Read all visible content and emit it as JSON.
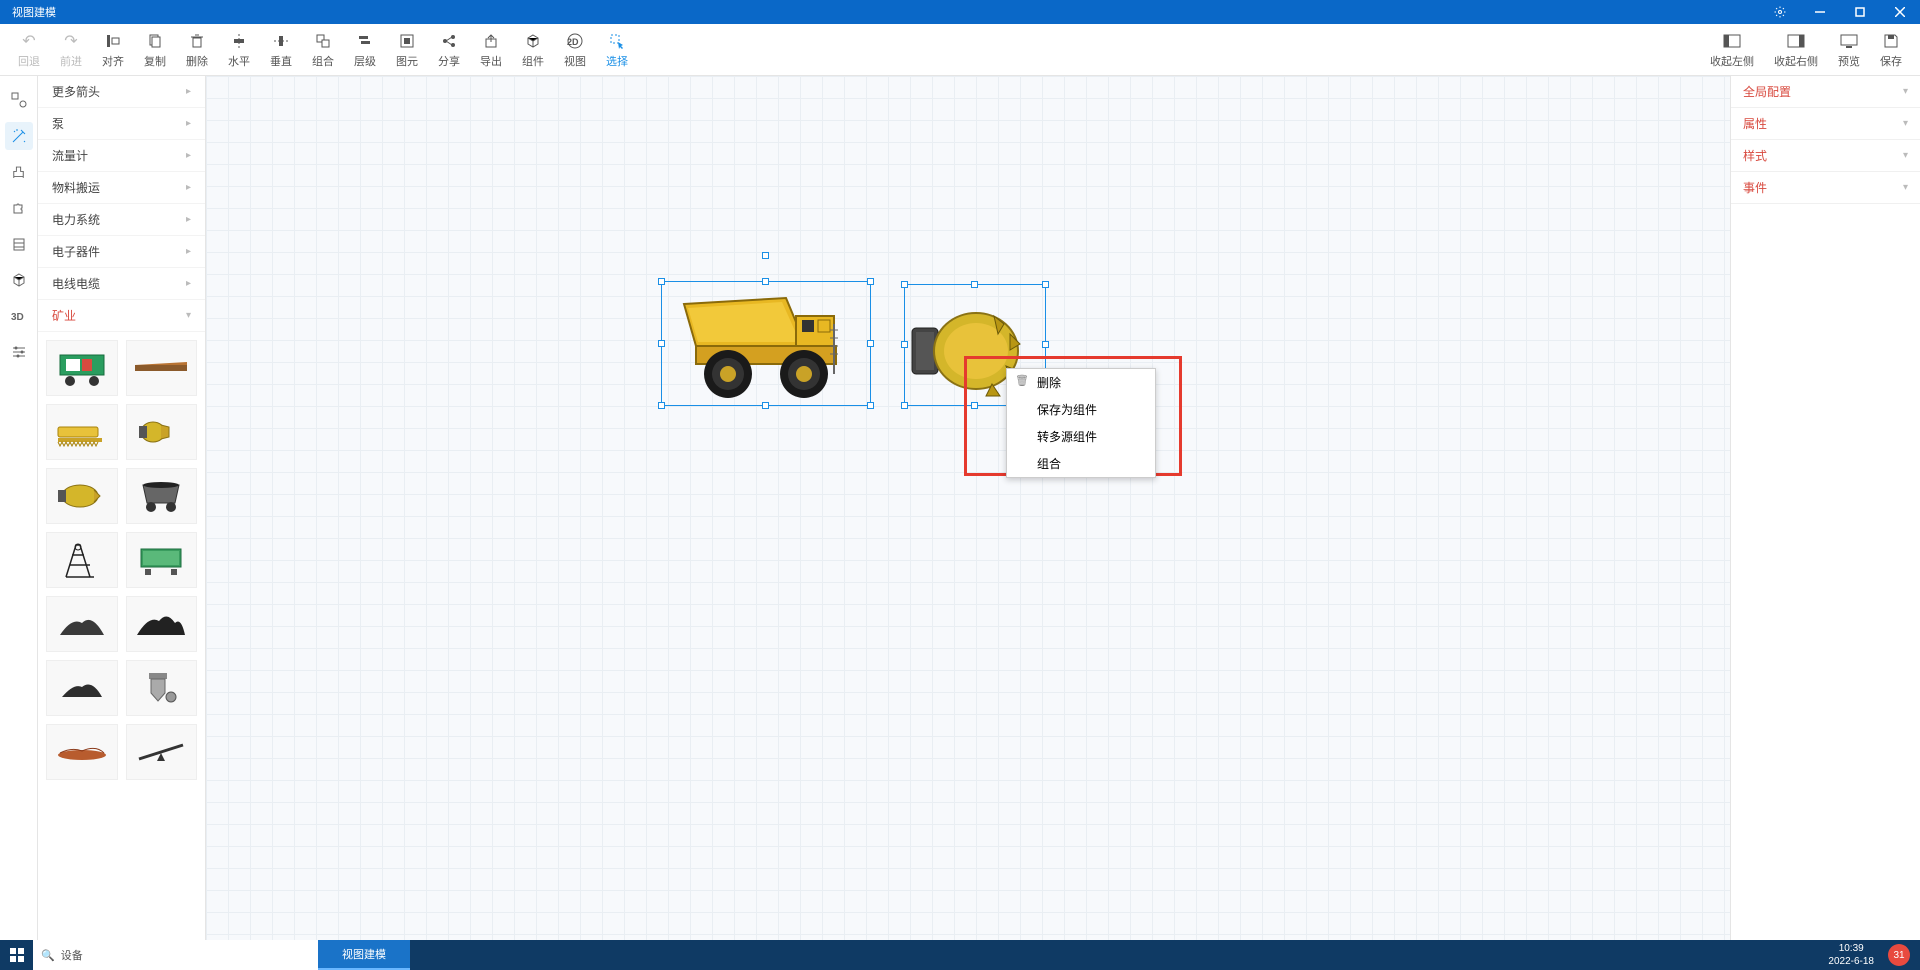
{
  "titlebar": {
    "title": "视图建模"
  },
  "toolbar": {
    "undo": "回退",
    "redo": "前进",
    "align": "对齐",
    "copy": "复制",
    "delete": "删除",
    "horiz": "水平",
    "vert": "垂直",
    "group": "组合",
    "layer": "层级",
    "element": "图元",
    "share": "分享",
    "export": "导出",
    "component": "组件",
    "view": "视图",
    "select": "选择",
    "collapse_left": "收起左侧",
    "collapse_right": "收起右侧",
    "preview": "预览",
    "save": "保存"
  },
  "sidebar_categories": [
    "更多箭头",
    "泵",
    "流量计",
    "物料搬运",
    "电力系统",
    "电子器件",
    "电线电缆",
    "矿业"
  ],
  "context_menu": {
    "delete": "删除",
    "save_as_component": "保存为组件",
    "convert_multisource": "转多源组件",
    "combine": "组合"
  },
  "right_panel": {
    "global": "全局配置",
    "properties": "属性",
    "style": "样式",
    "events": "事件"
  },
  "taskbar": {
    "search_placeholder": "设备",
    "app": "视图建模",
    "time": "10:39",
    "date": "2022-6-18",
    "badge": "31"
  }
}
